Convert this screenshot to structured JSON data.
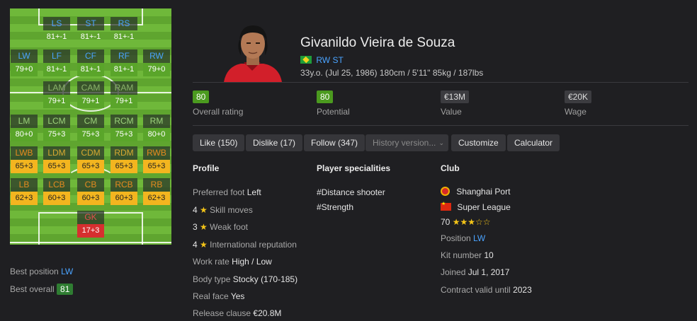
{
  "pitch": {
    "positions": [
      {
        "code": "LS",
        "value": "81+-1",
        "tone": "t-att"
      },
      {
        "code": "ST",
        "value": "81+-1",
        "tone": "t-att"
      },
      {
        "code": "RS",
        "value": "81+-1",
        "tone": "t-att"
      },
      {
        "code": "LW",
        "value": "79+0",
        "tone": "t-green"
      },
      {
        "code": "LF",
        "value": "81+-1",
        "tone": "t-green"
      },
      {
        "code": "CF",
        "value": "81+-1",
        "tone": "t-green"
      },
      {
        "code": "RF",
        "value": "81+-1",
        "tone": "t-green"
      },
      {
        "code": "RW",
        "value": "79+0",
        "tone": "t-green"
      },
      {
        "code": "LAM",
        "value": "79+1",
        "tone": "t-dim"
      },
      {
        "code": "CAM",
        "value": "79+1",
        "tone": "t-dim"
      },
      {
        "code": "RAM",
        "value": "79+1",
        "tone": "t-dim"
      },
      {
        "code": "LM",
        "value": "80+0",
        "tone": "t-mid"
      },
      {
        "code": "LCM",
        "value": "75+3",
        "tone": "t-mid"
      },
      {
        "code": "CM",
        "value": "75+3",
        "tone": "t-mid"
      },
      {
        "code": "RCM",
        "value": "75+3",
        "tone": "t-mid"
      },
      {
        "code": "RM",
        "value": "80+0",
        "tone": "t-mid"
      },
      {
        "code": "LWB",
        "value": "65+3",
        "tone": "t-yel orange"
      },
      {
        "code": "LDM",
        "value": "65+3",
        "tone": "t-yel"
      },
      {
        "code": "CDM",
        "value": "65+3",
        "tone": "t-yel"
      },
      {
        "code": "RDM",
        "value": "65+3",
        "tone": "t-yel"
      },
      {
        "code": "RWB",
        "value": "65+3",
        "tone": "t-yel orange"
      },
      {
        "code": "LB",
        "value": "62+3",
        "tone": "t-yel orange"
      },
      {
        "code": "LCB",
        "value": "60+3",
        "tone": "t-yel orange"
      },
      {
        "code": "CB",
        "value": "60+3",
        "tone": "t-yel orange"
      },
      {
        "code": "RCB",
        "value": "60+3",
        "tone": "t-yel orange"
      },
      {
        "code": "RB",
        "value": "62+3",
        "tone": "t-yel orange"
      },
      {
        "code": "GK",
        "value": "17+3",
        "tone": "t-red"
      }
    ]
  },
  "best": {
    "position_label": "Best position",
    "position_value": "LW",
    "overall_label": "Best overall",
    "overall_value": "81"
  },
  "player": {
    "name": "Givanildo Vieira de Souza",
    "positions": "RW ST",
    "info": "33y.o. (Jul 25, 1986) 180cm / 5'11\" 85kg / 187lbs"
  },
  "stats": {
    "overall_value": "80",
    "overall_label": "Overall rating",
    "potential_value": "80",
    "potential_label": "Potential",
    "value_value": "€13M",
    "value_label": "Value",
    "wage_value": "€20K",
    "wage_label": "Wage"
  },
  "actions": {
    "like": "Like (150)",
    "dislike": "Dislike (17)",
    "follow": "Follow (347)",
    "history": "History version...",
    "customize": "Customize",
    "calculator": "Calculator"
  },
  "profile": {
    "heading": "Profile",
    "preferred_foot_label": "Preferred foot",
    "preferred_foot": "Left",
    "skill_moves_num": "4",
    "skill_moves_label": "Skill moves",
    "weak_foot_num": "3",
    "weak_foot_label": "Weak foot",
    "intl_rep_num": "4",
    "intl_rep_label": "International reputation",
    "work_rate_label": "Work rate",
    "work_rate": "High / Low",
    "body_type_label": "Body type",
    "body_type": "Stocky (170-185)",
    "real_face_label": "Real face",
    "real_face": "Yes",
    "release_clause_label": "Release clause",
    "release_clause": "€20.8M"
  },
  "specialities": {
    "heading": "Player specialities",
    "items": [
      "#Distance shooter",
      "#Strength"
    ]
  },
  "club": {
    "heading": "Club",
    "name": "Shanghai Port",
    "league": "Super League",
    "rating": "70",
    "rating_stars": 3,
    "position_label": "Position",
    "position": "LW",
    "kit_label": "Kit number",
    "kit": "10",
    "joined_label": "Joined",
    "joined": "Jul 1, 2017",
    "contract_label": "Contract valid until",
    "contract": "2023"
  },
  "colors": {
    "accent_blue": "#4aa3ff",
    "rating_green": "#4b9a1f",
    "background": "#1f1f22"
  }
}
